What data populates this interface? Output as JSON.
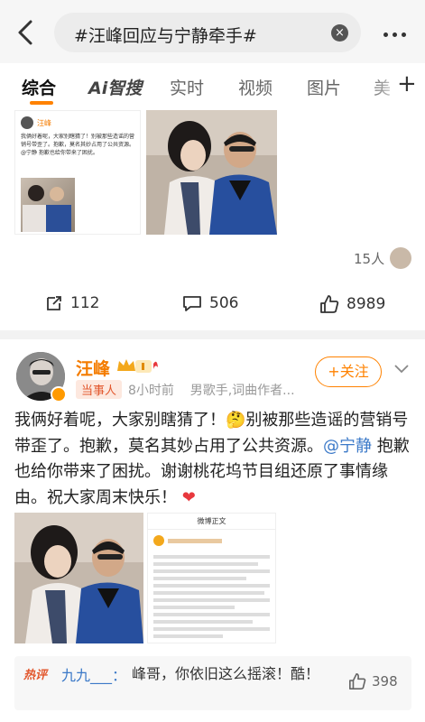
{
  "search": {
    "query": "#汪峰回应与宁静牵手#"
  },
  "tabs": [
    {
      "label": "综合"
    },
    {
      "label": "Ai智搜"
    },
    {
      "label": "实时"
    },
    {
      "label": "视频"
    },
    {
      "label": "图片"
    },
    {
      "label": "美"
    }
  ],
  "card1": {
    "likers": "15人",
    "actions": {
      "repost": "112",
      "comment": "506",
      "like": "8989"
    },
    "mini_post": {
      "author": "汪峰",
      "text": "我俩好着呢，大家别瞎猜了！别被那些造谣的营销号带歪了。抱歉，莫名其妙占用了公共资源。@宁静 抱歉也给你带来了困扰。"
    }
  },
  "post": {
    "author": "汪峰",
    "badge": "当事人",
    "time": "8小时前",
    "bio": "男歌手,词曲作者...",
    "follow_label": "+关注",
    "text_before": "我俩好着呢，大家别瞎猜了！🤔别被那些造谣的营销号带歪了。抱歉，莫名其妙占用了公共资源。",
    "mention": "@宁静",
    "text_after": " 抱歉也给你带来了困扰。谢谢桃花坞节目组还原了事情缘由。祝大家周末快乐！",
    "screenshot_title": "微博正文"
  },
  "hot_comment": {
    "tag": "热评",
    "user": "九九___",
    "text": "峰哥，你依旧这么摇滚！酷！",
    "likes": "398"
  },
  "colors": {
    "accent": "#ff8200",
    "link": "#3b79c8",
    "hot": "#e2572d"
  }
}
